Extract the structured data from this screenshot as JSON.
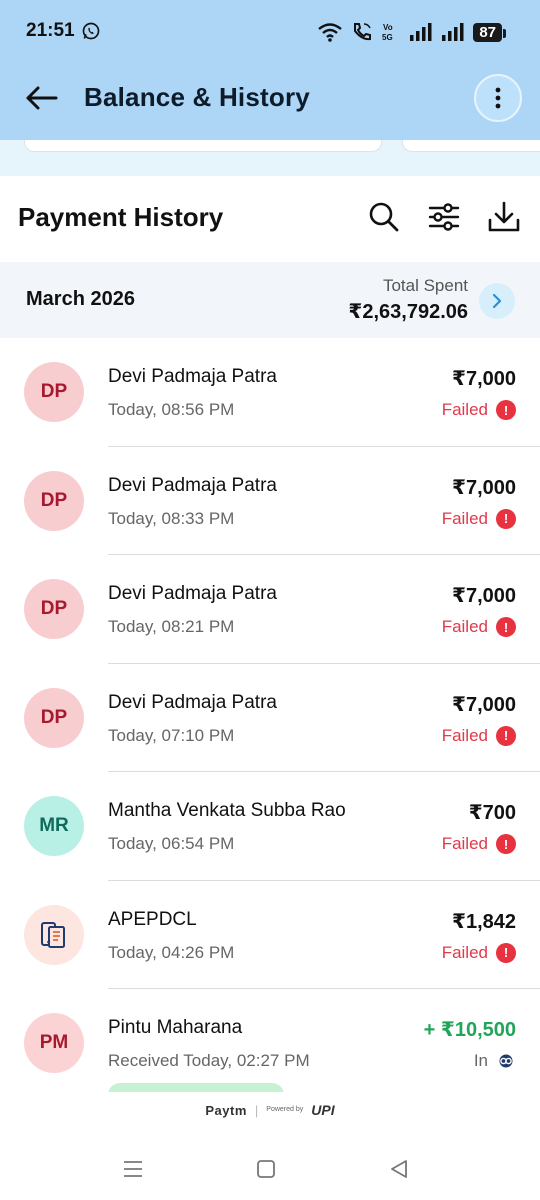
{
  "status_bar": {
    "time": "21:51",
    "battery": "87",
    "network_label": "Vo 5G"
  },
  "toolbar": {
    "title": "Balance & History"
  },
  "payment_history": {
    "title": "Payment History"
  },
  "month_summary": {
    "month": "March 2026",
    "total_label": "Total Spent",
    "total_value": "₹2,63,792.06"
  },
  "transactions": [
    {
      "initials": "DP",
      "name": "Devi Padmaja Patra",
      "time": "Today, 08:56 PM",
      "amount": "₹7,000",
      "status": "Failed",
      "avatar_bg": "#f8cdd0",
      "avatar_fg": "#a6192e"
    },
    {
      "initials": "DP",
      "name": "Devi Padmaja Patra",
      "time": "Today, 08:33 PM",
      "amount": "₹7,000",
      "status": "Failed",
      "avatar_bg": "#f8cdd0",
      "avatar_fg": "#a6192e"
    },
    {
      "initials": "DP",
      "name": "Devi Padmaja Patra",
      "time": "Today, 08:21 PM",
      "amount": "₹7,000",
      "status": "Failed",
      "avatar_bg": "#f8cdd0",
      "avatar_fg": "#a6192e"
    },
    {
      "initials": "DP",
      "name": "Devi Padmaja Patra",
      "time": "Today, 07:10 PM",
      "amount": "₹7,000",
      "status": "Failed",
      "avatar_bg": "#f8cdd0",
      "avatar_fg": "#a6192e"
    },
    {
      "initials": "MR",
      "name": "Mantha Venkata Subba Rao",
      "time": "Today, 06:54 PM",
      "amount": "₹700",
      "status": "Failed",
      "avatar_bg": "#b9f0e6",
      "avatar_fg": "#0f6b5c"
    },
    {
      "initials": "",
      "icon": "bill-receipt-icon",
      "name": "APEPDCL",
      "time": "Today, 04:26 PM",
      "amount": "₹1,842",
      "status": "Failed",
      "avatar_bg": "#fde6df",
      "avatar_fg": "#1f3b70"
    },
    {
      "initials": "PM",
      "name": "Pintu Maharana",
      "time": "Received Today, 02:27 PM",
      "amount": "+ ₹10,500",
      "status": "In",
      "avatar_bg": "#fcd3d5",
      "avatar_fg": "#a6192e",
      "amount_color": "#21a55a"
    }
  ],
  "footer": {
    "brand": "Paytm",
    "powered_by": "Powered by",
    "upi": "UPI"
  },
  "colors": {
    "header_bg": "#add5f6",
    "failed": "#e0394a",
    "received": "#21a55a"
  }
}
